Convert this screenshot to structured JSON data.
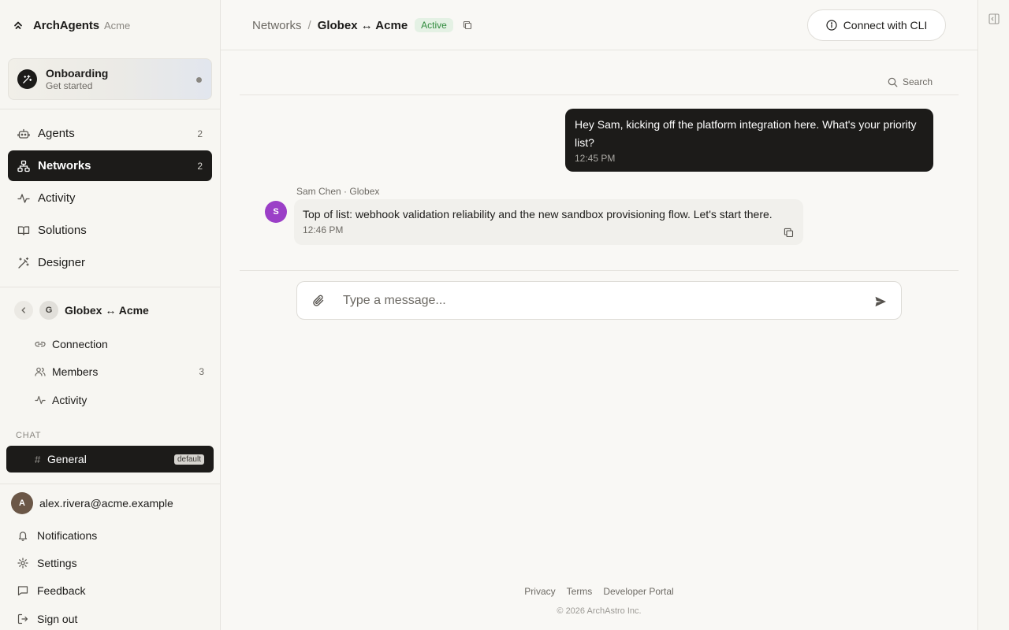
{
  "brand": {
    "name": "ArchAgents",
    "org": "Acme"
  },
  "onboarding": {
    "title": "Onboarding",
    "subtitle": "Get started"
  },
  "nav": {
    "agents": {
      "label": "Agents",
      "count": "2"
    },
    "networks": {
      "label": "Networks",
      "count": "2"
    },
    "activity": {
      "label": "Activity"
    },
    "solutions": {
      "label": "Solutions"
    },
    "designer": {
      "label": "Designer"
    }
  },
  "network": {
    "avatar": "G",
    "title": "Globex ↔ Acme",
    "items": {
      "connection": {
        "label": "Connection"
      },
      "members": {
        "label": "Members",
        "count": "3"
      },
      "activity": {
        "label": "Activity"
      }
    }
  },
  "chat": {
    "section": "CHAT",
    "channel": {
      "hash": "#",
      "name": "General",
      "badge": "default"
    }
  },
  "user": {
    "initial": "A",
    "email": "alex.rivera@acme.example"
  },
  "footer_nav": {
    "notifications": "Notifications",
    "settings": "Settings",
    "feedback": "Feedback",
    "signout": "Sign out"
  },
  "header": {
    "crumb_parent": "Networks",
    "crumb_sep": "/",
    "crumb_current": "Globex ↔ Acme",
    "status": "Active",
    "cli_button": "Connect with CLI"
  },
  "search": {
    "label": "Search"
  },
  "messages": {
    "outgoing": {
      "text": "Hey Sam, kicking off the platform integration here. What's your priority list?",
      "time": "12:45 PM"
    },
    "incoming": {
      "avatar": "S",
      "author": "Sam Chen · Globex",
      "text": "Top of list: webhook validation reliability and the new sandbox provisioning flow. Let's start there.",
      "time": "12:46 PM"
    }
  },
  "composer": {
    "placeholder": "Type a message...",
    "value": ""
  },
  "footer": {
    "links": {
      "privacy": "Privacy",
      "terms": "Terms",
      "developer": "Developer Portal"
    },
    "copyright": "© 2026 ArchAstro Inc."
  },
  "colors": {
    "accent_dark": "#1c1b19",
    "status_green": "#2f8a3c",
    "avatar_purple": "#9b3fc7",
    "background": "#f9f8f5"
  }
}
